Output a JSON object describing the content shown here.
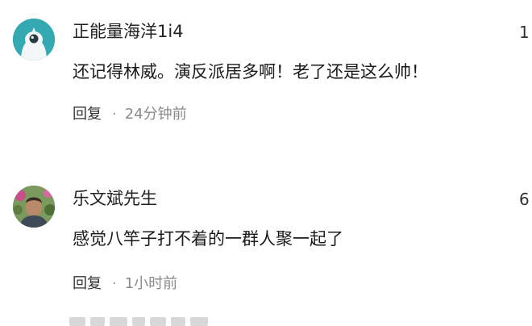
{
  "comments": [
    {
      "username": "正能量海洋1i4",
      "likes": "1",
      "content": "还记得林威。演反派居多啊！老了还是这么帅！",
      "reply_label": "回复",
      "separator": "·",
      "time": "24分钟前",
      "avatar_icon": "teal-cartoon-avatar-icon"
    },
    {
      "username": "乐文斌先生",
      "likes": "6",
      "content": "感觉八竿子打不着的一群人聚一起了",
      "reply_label": "回复",
      "separator": "·",
      "time": "1小时前",
      "avatar_icon": "photo-avatar"
    }
  ],
  "colors": {
    "avatar_teal": "#35a9b2",
    "text_primary": "#1a1a1a",
    "text_meta": "#8a8a8a"
  }
}
